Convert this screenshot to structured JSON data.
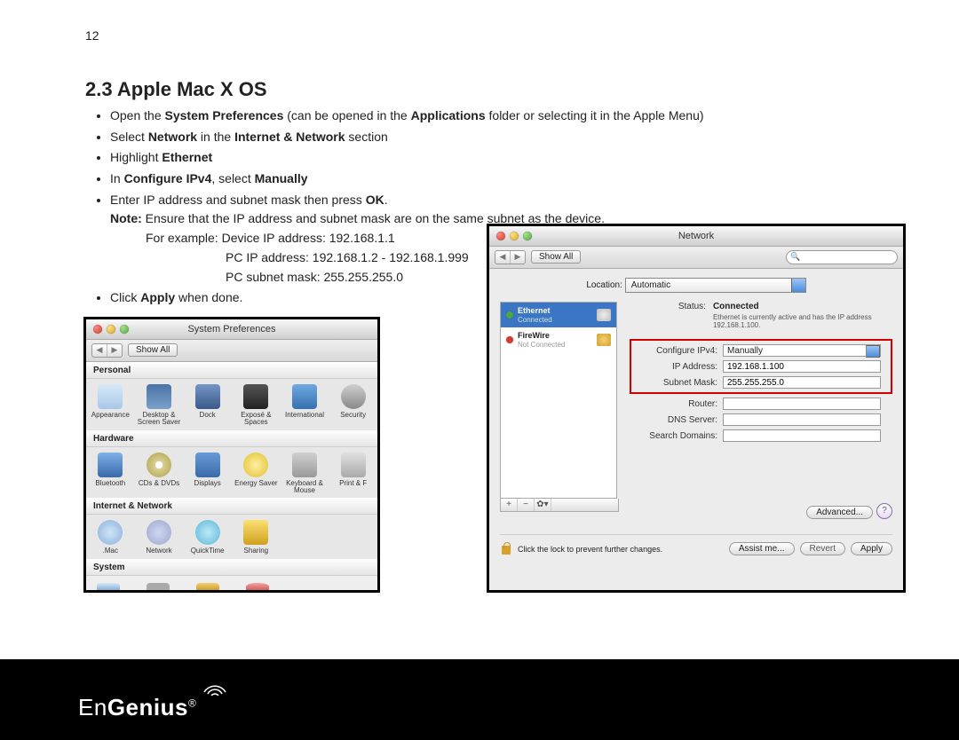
{
  "page": {
    "number": "12"
  },
  "section": {
    "heading": "2.3   Apple Mac X OS"
  },
  "bullets": {
    "i0a": "Open the ",
    "i0b": "System Preferences",
    "i0c": " (can be opened in the ",
    "i0d": "Applications",
    "i0e": " folder or selecting it in the Apple Menu)",
    "i1a": "Select ",
    "i1b": "Network",
    "i1c": " in the ",
    "i1d": "Internet & Network",
    "i1e": " section",
    "i2a": "Highlight ",
    "i2b": "Ethernet",
    "i3a": "In ",
    "i3b": "Configure IPv4",
    "i3c": ", select ",
    "i3d": "Manually",
    "i4a": "Enter IP address and subnet mask then press ",
    "i4b": "OK",
    "i4c": ".",
    "noteL": "Note:",
    "noteT": " Ensure that the IP address and subnet mask are on the same subnet as the device.",
    "exL": "For example:      Device IP address: 192.168.1.1",
    "ex2": "PC IP address: 192.168.1.2 - 192.168.1.999",
    "ex3": "PC subnet mask: 255.255.255.0",
    "i5a": "Click ",
    "i5b": "Apply",
    "i5c": " when done."
  },
  "sysprefs": {
    "title": "System Preferences",
    "showAll": "Show All",
    "sections": {
      "personal": {
        "label": "Personal",
        "items": [
          "Appearance",
          "Desktop & Screen Saver",
          "Dock",
          "Exposé & Spaces",
          "International",
          "Security"
        ]
      },
      "hardware": {
        "label": "Hardware",
        "items": [
          "Bluetooth",
          "CDs & DVDs",
          "Displays",
          "Energy Saver",
          "Keyboard & Mouse",
          "Print & F"
        ]
      },
      "internet": {
        "label": "Internet & Network",
        "items": [
          ".Mac",
          "Network",
          "QuickTime",
          "Sharing"
        ]
      },
      "system": {
        "label": "System"
      }
    }
  },
  "network": {
    "title": "Network",
    "showAll": "Show All",
    "searchPlaceholder": "",
    "locationLabel": "Location:",
    "locationValue": "Automatic",
    "side": {
      "ethernet": {
        "name": "Ethernet",
        "status": "Connected"
      },
      "firewire": {
        "name": "FireWire",
        "status": "Not Connected"
      }
    },
    "status": {
      "label": "Status:",
      "value": "Connected",
      "sub": "Ethernet is currently active and has the IP address 192.168.1.100."
    },
    "fields": {
      "configLabel": "Configure IPv4:",
      "configValue": "Manually",
      "ipLabel": "IP Address:",
      "ipValue": "192.168.1.100",
      "maskLabel": "Subnet Mask:",
      "maskValue": "255.255.255.0",
      "routerLabel": "Router:",
      "routerValue": "",
      "dnsLabel": "DNS Server:",
      "dnsValue": "",
      "domainsLabel": "Search Domains:",
      "domainsValue": ""
    },
    "advanced": "Advanced...",
    "help": "?",
    "lockText": "Click the lock to prevent further changes.",
    "buttons": {
      "assist": "Assist me...",
      "revert": "Revert",
      "apply": "Apply"
    }
  },
  "footer": {
    "brand1": "En",
    "brand2": "Genius",
    "reg": "®"
  }
}
